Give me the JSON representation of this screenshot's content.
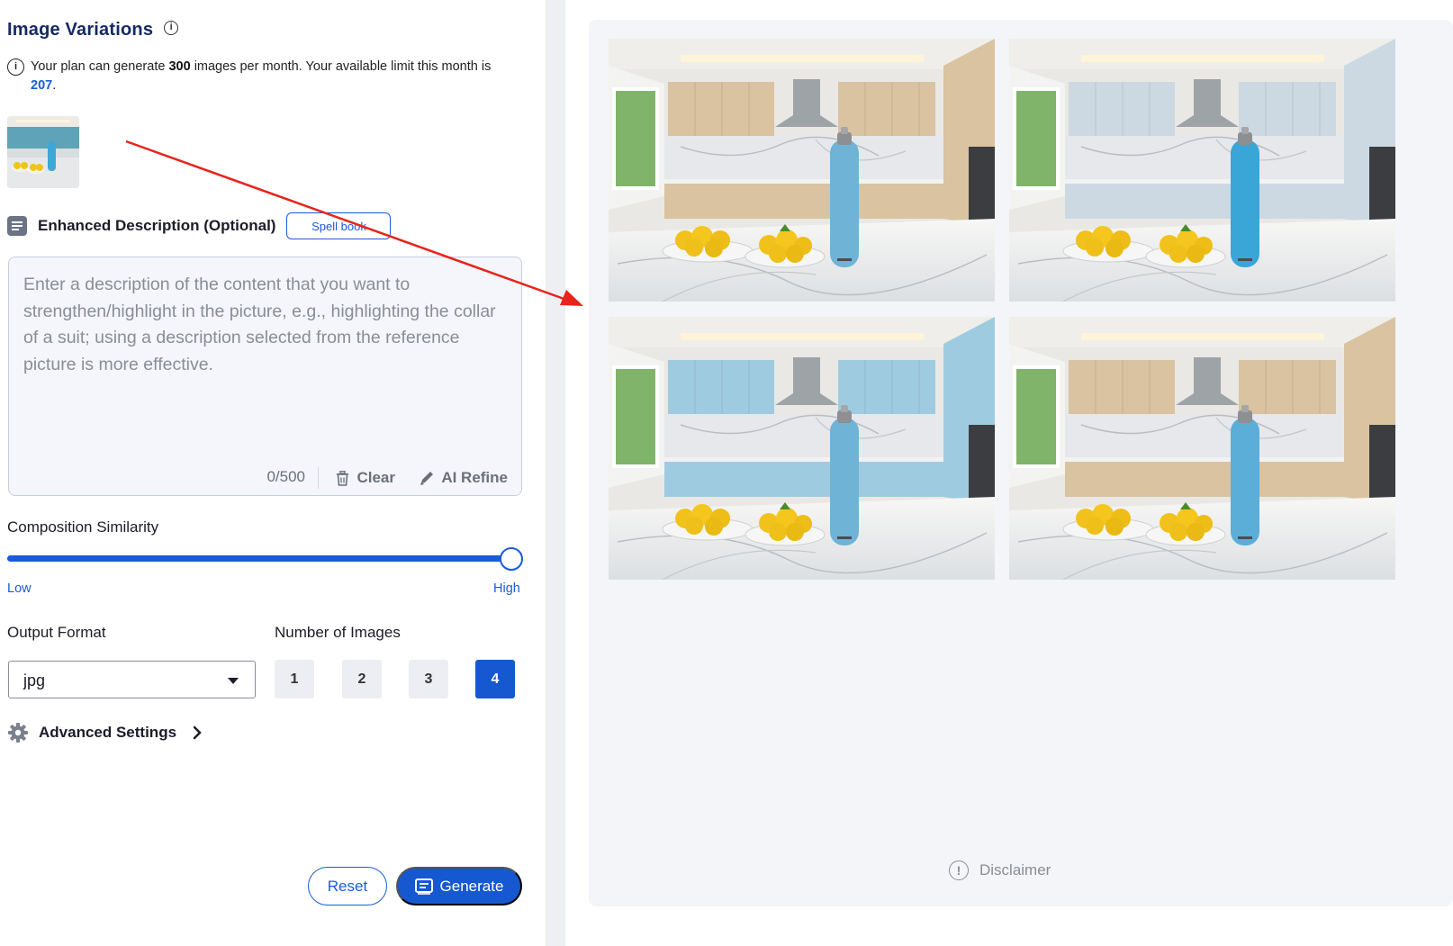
{
  "panel": {
    "title": "Image Variations",
    "plan": {
      "text_before": "Your plan can generate",
      "monthly_images": "300",
      "text_middle": "images per month. Your available limit this month is",
      "available": "207",
      "text_after": "."
    },
    "description": {
      "title": "Enhanced Description (Optional)",
      "spell_button": "Spell book",
      "placeholder": "Enter a description of the content that you want to strengthen/highlight in the picture, e.g., highlighting the collar of a suit; using a description selected from the reference picture is more effective.",
      "counter": "0/500",
      "clear_label": "Clear",
      "refine_label": "AI Refine"
    },
    "similarity": {
      "label": "Composition Similarity",
      "low": "Low",
      "high": "High",
      "value": 1.0
    },
    "output_format": {
      "label": "Output Format",
      "selected": "jpg"
    },
    "number_of_images": {
      "label": "Number of Images",
      "options": [
        "1",
        "2",
        "3",
        "4"
      ],
      "selected": "4"
    },
    "advanced_label": "Advanced Settings",
    "reset_label": "Reset",
    "generate_label": "Generate"
  },
  "results": {
    "disclaimer": "Disclaimer",
    "images": [
      {
        "cabinet": "#d9c3a1",
        "bottle": "#6fb3d6"
      },
      {
        "cabinet": "#cdd9e2",
        "bottle": "#3aa6d8"
      },
      {
        "cabinet": "#9fcbe0",
        "bottle": "#6fb3d6"
      },
      {
        "cabinet": "#d9c3a1",
        "bottle": "#5aaed8"
      }
    ]
  },
  "colors": {
    "accent": "#1558d0",
    "annotation_arrow": "#e8231c"
  }
}
